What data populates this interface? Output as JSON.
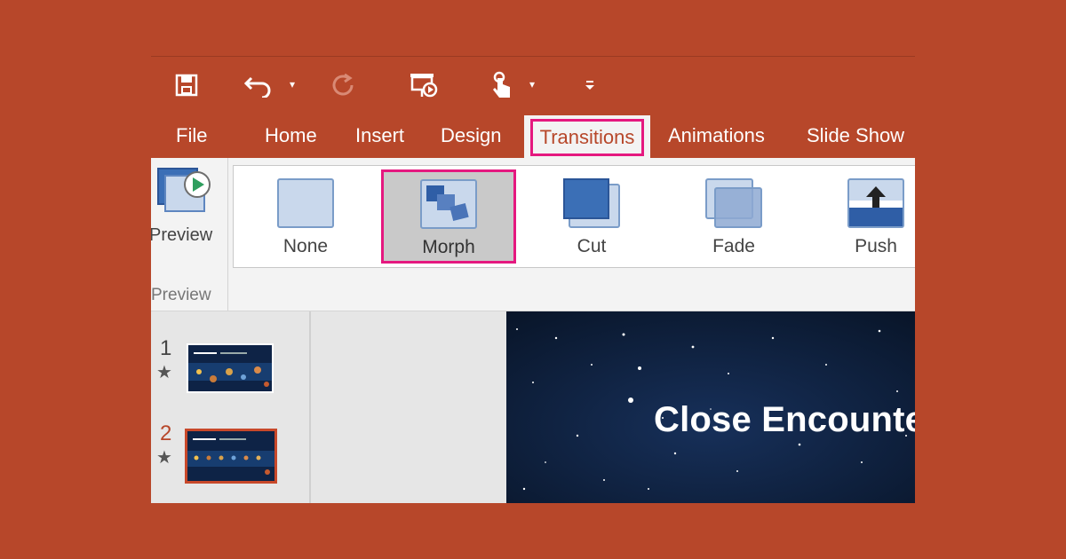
{
  "qat": {
    "items": [
      {
        "name": "save-icon"
      },
      {
        "name": "undo-icon"
      },
      {
        "name": "redo-icon"
      },
      {
        "name": "start-from-beginning-icon"
      },
      {
        "name": "touch-mode-icon"
      },
      {
        "name": "customize-qat-icon"
      }
    ]
  },
  "tabs": [
    "File",
    "Home",
    "Insert",
    "Design",
    "Transitions",
    "Animations",
    "Slide Show"
  ],
  "active_tab": "Transitions",
  "ribbon": {
    "preview_button_label": "Preview",
    "preview_group_label": "Preview",
    "transitions": [
      {
        "label": "None"
      },
      {
        "label": "Morph",
        "selected": true
      },
      {
        "label": "Cut"
      },
      {
        "label": "Fade"
      },
      {
        "label": "Push"
      }
    ]
  },
  "slides": [
    {
      "number": "1",
      "selected": false
    },
    {
      "number": "2",
      "selected": true
    }
  ],
  "slide": {
    "title": "Close Encounte"
  },
  "colors": {
    "accent": "#B7472A",
    "highlight": "#E5187F",
    "ribbon": "#F3F3F3",
    "slide_bg": "#0B1A33"
  }
}
